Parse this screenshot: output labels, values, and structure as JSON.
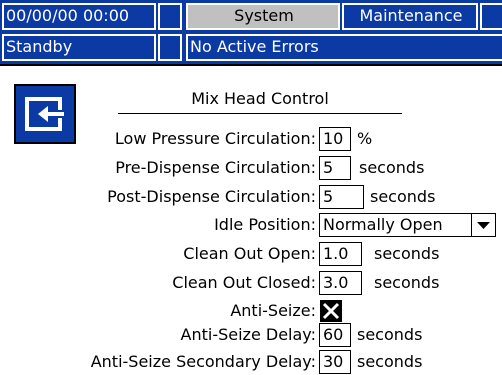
{
  "header": {
    "datetime": "00/00/00 00:00",
    "tabs": [
      {
        "label": "System",
        "active": true
      },
      {
        "label": "Maintenance",
        "active": false
      }
    ],
    "status": "Standby",
    "errors": "No Active Errors"
  },
  "screen": {
    "title": "Mix Head Control",
    "back_icon": "exit-screen-icon",
    "fields": {
      "low_pressure_circulation": {
        "label": "Low Pressure Circulation:",
        "value": "10",
        "unit": "%"
      },
      "pre_dispense_circulation": {
        "label": "Pre-Dispense Circulation:",
        "value": "5",
        "unit": "seconds"
      },
      "post_dispense_circulation": {
        "label": "Post-Dispense Circulation:",
        "value": "5",
        "unit": "seconds"
      },
      "idle_position": {
        "label": "Idle Position:",
        "value": "Normally Open"
      },
      "clean_out_open": {
        "label": "Clean Out Open:",
        "value": "1.0",
        "unit": "seconds"
      },
      "clean_out_closed": {
        "label": "Clean Out Closed:",
        "value": "3.0",
        "unit": "seconds"
      },
      "anti_seize": {
        "label": "Anti-Seize:",
        "checked": true
      },
      "anti_seize_delay": {
        "label": "Anti-Seize Delay:",
        "value": "60",
        "unit": "seconds"
      },
      "anti_seize_secondary_delay": {
        "label": "Anti-Seize Secondary Delay:",
        "value": "30",
        "unit": "seconds"
      }
    }
  },
  "colors": {
    "header_blue": "#0b3aa4",
    "tab_active": "#c0c0c0"
  }
}
